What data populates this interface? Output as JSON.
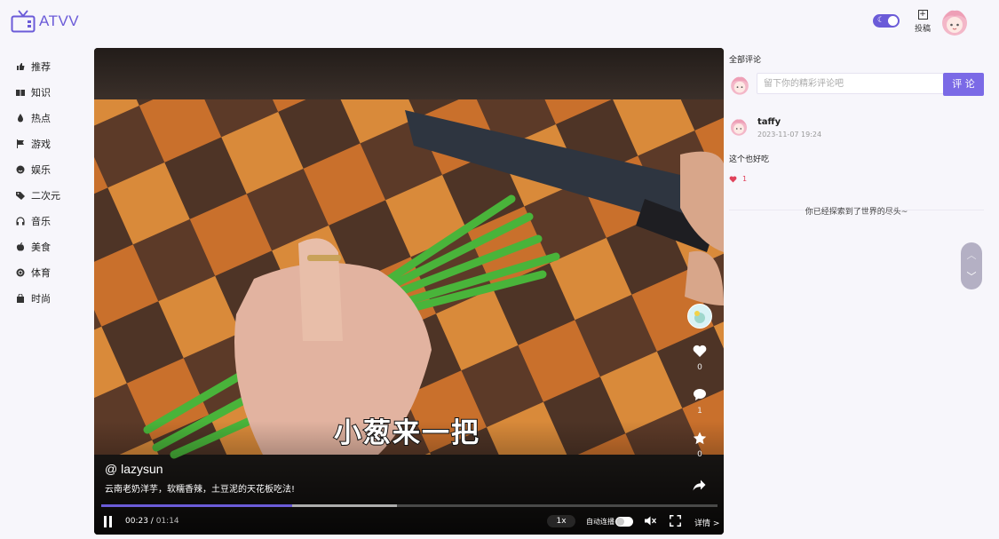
{
  "app": {
    "name": "ATVV"
  },
  "header": {
    "upload_label": "投稿"
  },
  "sidebar": {
    "items": [
      {
        "label": "推荐",
        "icon": "thumbs-up-icon"
      },
      {
        "label": "知识",
        "icon": "book-icon"
      },
      {
        "label": "热点",
        "icon": "fire-icon"
      },
      {
        "label": "游戏",
        "icon": "flag-icon"
      },
      {
        "label": "娱乐",
        "icon": "smile-icon"
      },
      {
        "label": "二次元",
        "icon": "tag-icon"
      },
      {
        "label": "音乐",
        "icon": "headphones-icon"
      },
      {
        "label": "美食",
        "icon": "apple-icon"
      },
      {
        "label": "体育",
        "icon": "ball-icon"
      },
      {
        "label": "时尚",
        "icon": "bag-icon"
      }
    ]
  },
  "video": {
    "subtitle": "小葱来一把",
    "author": "@ lazysun",
    "description": "云南老奶洋芋，软糯香辣，土豆泥的天花板吃法!",
    "likes": "0",
    "comments": "1",
    "favorites": "0",
    "current_time": "00:23",
    "separator": " / ",
    "duration": "01:14",
    "played_fraction": 0.31,
    "buffered_fraction": 0.48,
    "speed": "1x",
    "autoplay_label": "自动连播",
    "details_label": "详情 >"
  },
  "comments_panel": {
    "title": "全部评论",
    "placeholder": "留下你的精彩评论吧",
    "submit_label": "评 论",
    "items": [
      {
        "user": "taffy",
        "time": "2023-11-07 19:24",
        "text": "这个也好吃",
        "likes": "1"
      }
    ],
    "end_note": "你已经探索到了世界的尽头~"
  },
  "colors": {
    "accent": "#6b5bd8",
    "button": "#7b6ae6",
    "like": "#e0425b"
  }
}
